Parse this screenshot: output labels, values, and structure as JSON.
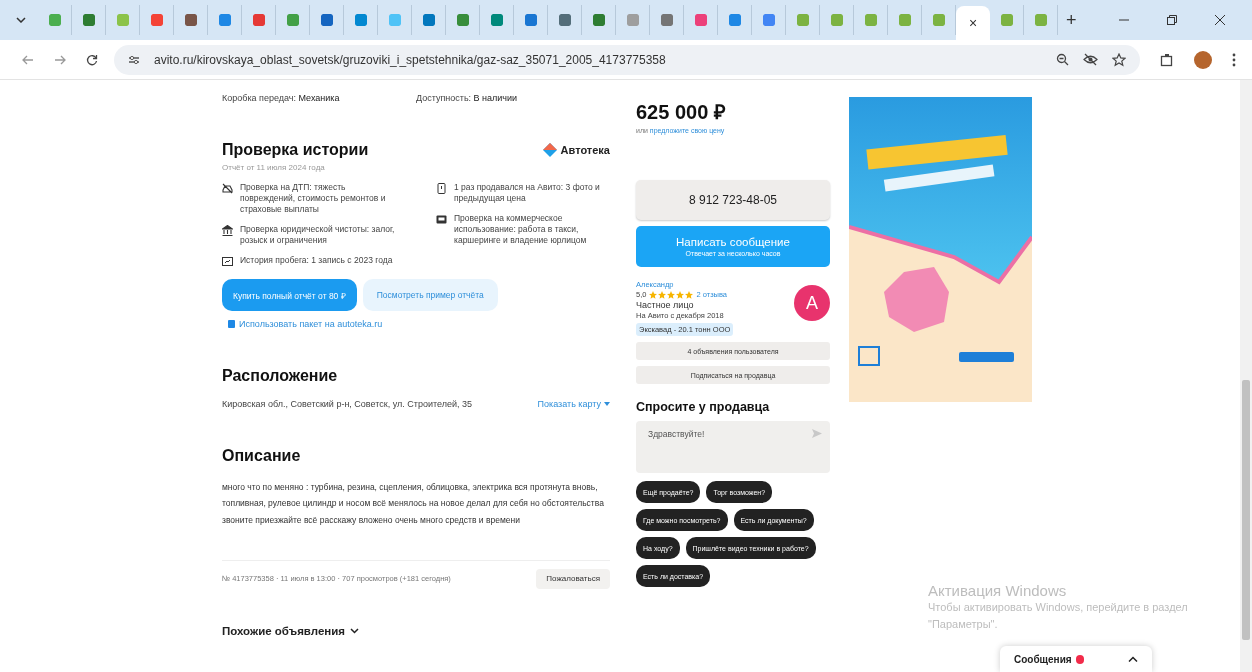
{
  "browser": {
    "tabs": [
      {
        "color": "#4caf50",
        "selected": false
      },
      {
        "color": "#2e7d32",
        "selected": false
      },
      {
        "color": "#8bc34a",
        "selected": false
      },
      {
        "color": "#f44336",
        "selected": false
      },
      {
        "color": "#795548",
        "selected": false
      },
      {
        "color": "#1e88e5",
        "selected": false
      },
      {
        "color": "#e53935",
        "selected": false
      },
      {
        "color": "#43a047",
        "selected": false
      },
      {
        "color": "#1565c0",
        "selected": false
      },
      {
        "color": "#0288d1",
        "selected": false
      },
      {
        "color": "#4fc3f7",
        "selected": false
      },
      {
        "color": "#0277bd",
        "selected": false
      },
      {
        "color": "#388e3c",
        "selected": false
      },
      {
        "color": "#00897b",
        "selected": false
      },
      {
        "color": "#1976d2",
        "selected": false
      },
      {
        "color": "#546e7a",
        "selected": false
      },
      {
        "color": "#2e7d32",
        "selected": false
      },
      {
        "color": "#9e9e9e",
        "selected": false
      },
      {
        "color": "#757575",
        "selected": false
      },
      {
        "color": "#ec407a",
        "selected": false
      },
      {
        "color": "#1e88e5",
        "selected": false
      },
      {
        "color": "#4285f4",
        "selected": false
      },
      {
        "color": "#7cb342",
        "selected": false
      },
      {
        "color": "#7cb342",
        "selected": false
      },
      {
        "color": "#7cb342",
        "selected": false
      },
      {
        "color": "#7cb342",
        "selected": false
      },
      {
        "color": "#7cb342",
        "selected": false
      },
      {
        "selected": true
      },
      {
        "color": "#7cb342",
        "selected": false
      },
      {
        "color": "#7cb342",
        "selected": false
      }
    ],
    "close_tab": "×",
    "new_tab": "+",
    "url": "avito.ru/kirovskaya_oblast_sovetsk/gruzoviki_i_spetstehnika/gaz-saz_35071_2005_4173775358"
  },
  "specs": [
    {
      "label": "Коробка передач: ",
      "value": "Механика"
    },
    {
      "label": "Доступность: ",
      "value": "В наличии"
    }
  ],
  "history": {
    "title": "Проверка истории",
    "brand": "Автотека",
    "subtitle": "Отчёт от 11 июля 2024 года",
    "items_left": [
      "Проверка на ДТП: тяжесть повреждений, стоимость ремонтов и страховые выплаты",
      "Проверка юридической чистоты: залог, розыск и ограничения",
      "История пробега: 1 запись с 2023 года"
    ],
    "items_right": [
      "1 раз продавался на Авито: 3 фото и предыдущая цена",
      "Проверка на коммерческое использование: работа в такси, каршеринге и владение юрлицом"
    ],
    "buy_button": "Купить полный отчёт от 80 ₽",
    "example_button": "Посмотреть пример отчёта",
    "package_link": "Использовать пакет на autoteka.ru"
  },
  "location": {
    "title": "Расположение",
    "address": "Кировская обл., Советский р-н, Советск, ул. Строителей, 35",
    "map_link": "Показать карту"
  },
  "description": {
    "title": "Описание",
    "text": "много что по меняно : турбина, резина, сцепления, облицовка, электрика вся протянута вновь, топливная, рулевое цилиндр и носом всё менялось на новое делал для себя но обстоятельства звоните приезжайте всё расскажу вложено очень много средств и времени"
  },
  "meta": {
    "text": "№ 4173775358 · 11 июля в 13:00 · 707 просмотров (+181 сегодня)",
    "report_button": "Пожаловаться"
  },
  "similar": {
    "title": "Похожие объявления"
  },
  "price": {
    "value": "625 000 ₽",
    "prefix": "или ",
    "offer_link": "предложите свою цену"
  },
  "contact": {
    "phone": "8 912 723-48-05",
    "message_button": "Написать сообщение",
    "message_hint": "Отвечает за несколько часов"
  },
  "seller": {
    "name": "Александр",
    "rating": "5,0",
    "stars": 5,
    "reviews": "2 отзыва",
    "type": "Частное лицо",
    "since": "На Авито с декабря 2018",
    "tag": "Экскавад - 20.1 тонн ООО",
    "avatar_letter": "А",
    "ads_button": "4 объявления пользователя",
    "subscribe_button": "Подписаться на продавца"
  },
  "ask": {
    "title": "Спросите у продавца",
    "value": "Здравствуйте!",
    "chips": [
      "Ещё продаёте?",
      "Торг возможен?",
      "Где можно посмотреть?",
      "Есть ли документы?",
      "На ходу?",
      "Пришлёте видео техники в работе?",
      "Есть ли доставка?"
    ]
  },
  "windows_notice": {
    "title": "Активация Windows",
    "text": "Чтобы активировать Windows, перейдите в раздел \"Параметры\"."
  },
  "messages_bar": {
    "label": "Сообщения"
  }
}
